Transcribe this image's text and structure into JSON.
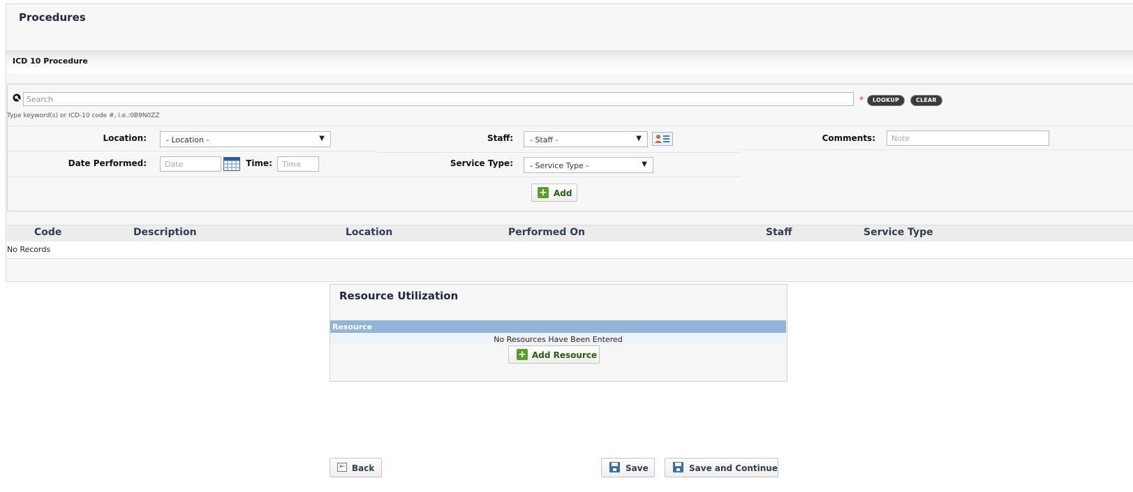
{
  "procedures": {
    "title": "Procedures",
    "section_title": "ICD 10 Procedure",
    "search": {
      "placeholder": "Search",
      "hint": "Type keyword(s) or ICD-10 code #, i.e.:0B9N0ZZ",
      "required_marker": "*",
      "lookup_label": "LOOKUP",
      "clear_label": "CLEAR"
    },
    "form": {
      "location_label": "Location:",
      "location_value": "- Location -",
      "staff_label": "Staff:",
      "staff_value": "- Staff -",
      "comments_label": "Comments:",
      "comments_placeholder": "Note",
      "date_label": "Date Performed:",
      "date_placeholder": "Date",
      "time_label": "Time:",
      "time_placeholder": "Time",
      "service_type_label": "Service Type:",
      "service_type_value": "- Service Type -",
      "add_label": "Add"
    },
    "table": {
      "columns": [
        "Code",
        "Description",
        "Location",
        "Performed On",
        "Staff",
        "Service Type"
      ],
      "empty_text": "No Records"
    }
  },
  "resource_utilization": {
    "title": "Resource Utilization",
    "column": "Resource",
    "empty_text": "No Resources Have Been Entered",
    "add_label": "Add Resource"
  },
  "footer": {
    "back_label": "Back",
    "save_label": "Save",
    "save_continue_label": "Save and Continue"
  },
  "colors": {
    "accent_green": "#5a9d2b",
    "resource_header": "#92b4d6",
    "save_icon": "#3c6ea5"
  }
}
